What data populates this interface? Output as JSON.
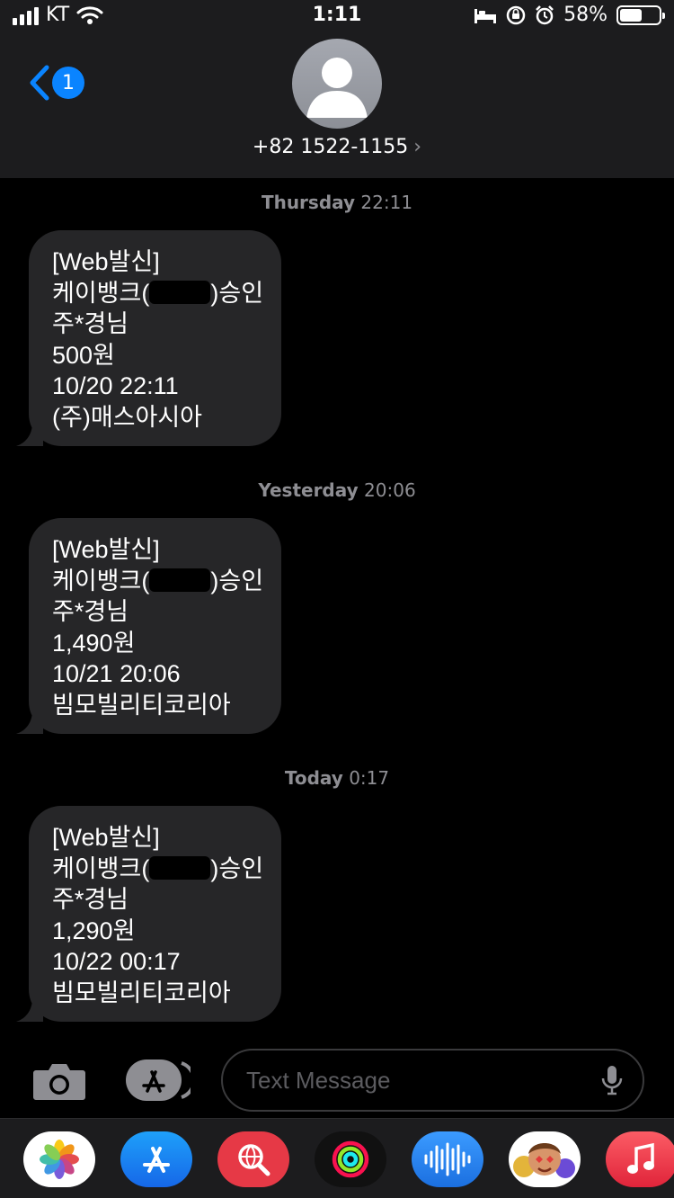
{
  "status_bar": {
    "carrier": "KT",
    "time": "1:11",
    "battery": "58%",
    "battery_level": 0.58
  },
  "header": {
    "back_badge": "1",
    "contact": "+82 1522-1155",
    "chevron": "›"
  },
  "messages": [
    {
      "timestamp_day": "Thursday",
      "timestamp_time": "22:11",
      "lines": [
        "[Web발신]",
        "케이뱅크(",
        ")승인",
        "주*경님",
        "500원",
        "10/20 22:11",
        "(주)매스아시아"
      ]
    },
    {
      "timestamp_day": "Yesterday",
      "timestamp_time": "20:06",
      "lines": [
        "[Web발신]",
        "케이뱅크(",
        ")승인",
        "주*경님",
        "1,490원",
        "10/21 20:06",
        "빔모빌리티코리아"
      ]
    },
    {
      "timestamp_day": "Today",
      "timestamp_time": "0:17",
      "lines": [
        "[Web발신]",
        "케이뱅크(",
        ")승인",
        "주*경님",
        "1,290원",
        "10/22 00:17",
        "빔모빌리티코리아"
      ]
    }
  ],
  "composer": {
    "placeholder": "Text Message"
  },
  "dock": {
    "apps": [
      "photos-icon",
      "app-store-icon",
      "search-web-icon",
      "activity-icon",
      "audio-messages-icon",
      "memoji-icon",
      "music-icon"
    ]
  },
  "colors": {
    "accent": "#0a84ff",
    "bubble": "#262628",
    "header": "#1c1c1e"
  }
}
